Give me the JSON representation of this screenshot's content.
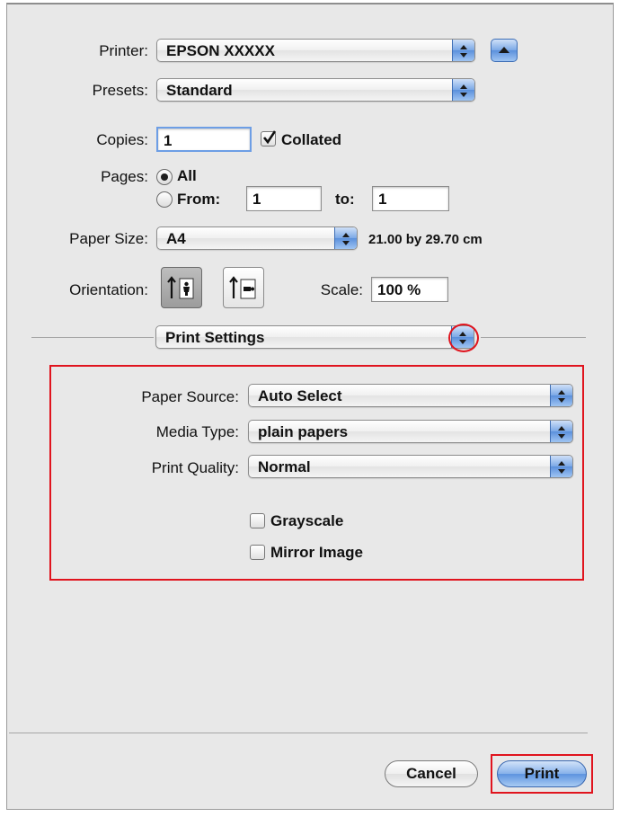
{
  "printer": {
    "label": "Printer:",
    "value": "EPSON XXXXX"
  },
  "presets": {
    "label": "Presets:",
    "value": "Standard"
  },
  "copies": {
    "label": "Copies:",
    "value": "1",
    "collated_label": "Collated",
    "collated": true
  },
  "pages": {
    "label": "Pages:",
    "all_label": "All",
    "from_label": "From:",
    "from_value": "1",
    "to_label": "to:",
    "to_value": "1",
    "selected": "All"
  },
  "paper_size": {
    "label": "Paper Size:",
    "value": "A4",
    "dimensions": "21.00 by 29.70 cm"
  },
  "orientation": {
    "label": "Orientation:",
    "selected": "portrait"
  },
  "scale": {
    "label": "Scale:",
    "value": "100 %"
  },
  "panel_menu": {
    "value": "Print Settings"
  },
  "print_settings": {
    "paper_source": {
      "label": "Paper Source:",
      "value": "Auto Select"
    },
    "media_type": {
      "label": "Media Type:",
      "value": "plain papers"
    },
    "print_quality": {
      "label": "Print Quality:",
      "value": "Normal"
    },
    "grayscale_label": "Grayscale",
    "mirror_label": "Mirror Image"
  },
  "buttons": {
    "cancel": "Cancel",
    "print": "Print"
  },
  "colors": {
    "highlight": "#e0141e",
    "accent_blue": "#5b90dc"
  }
}
